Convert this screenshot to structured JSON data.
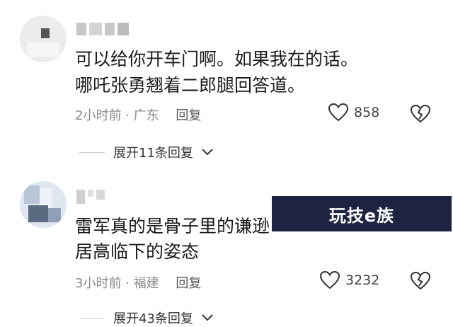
{
  "comments": [
    {
      "text_line1": "可以给你开车门啊。如果我在的话。",
      "text_line2": "哪吒张勇翘着二郎腿回答道。",
      "time": "2小时前",
      "location": "广东",
      "reply_label": "回复",
      "likes": "858",
      "expand_label": "展开11条回复"
    },
    {
      "text_line1": "雷军真的是骨子里的谦逊",
      "text_line2": "居高临下的姿态",
      "time": "3小时前",
      "location": "福建",
      "reply_label": "回复",
      "likes": "3232",
      "expand_label": "展开43条回复"
    }
  ],
  "watermark": {
    "text": "玩技e族",
    "bg_color": "#1d2340"
  },
  "icons": {
    "like": "heart-outline-icon",
    "dislike": "broken-heart-icon",
    "expand": "chevron-down-icon"
  }
}
